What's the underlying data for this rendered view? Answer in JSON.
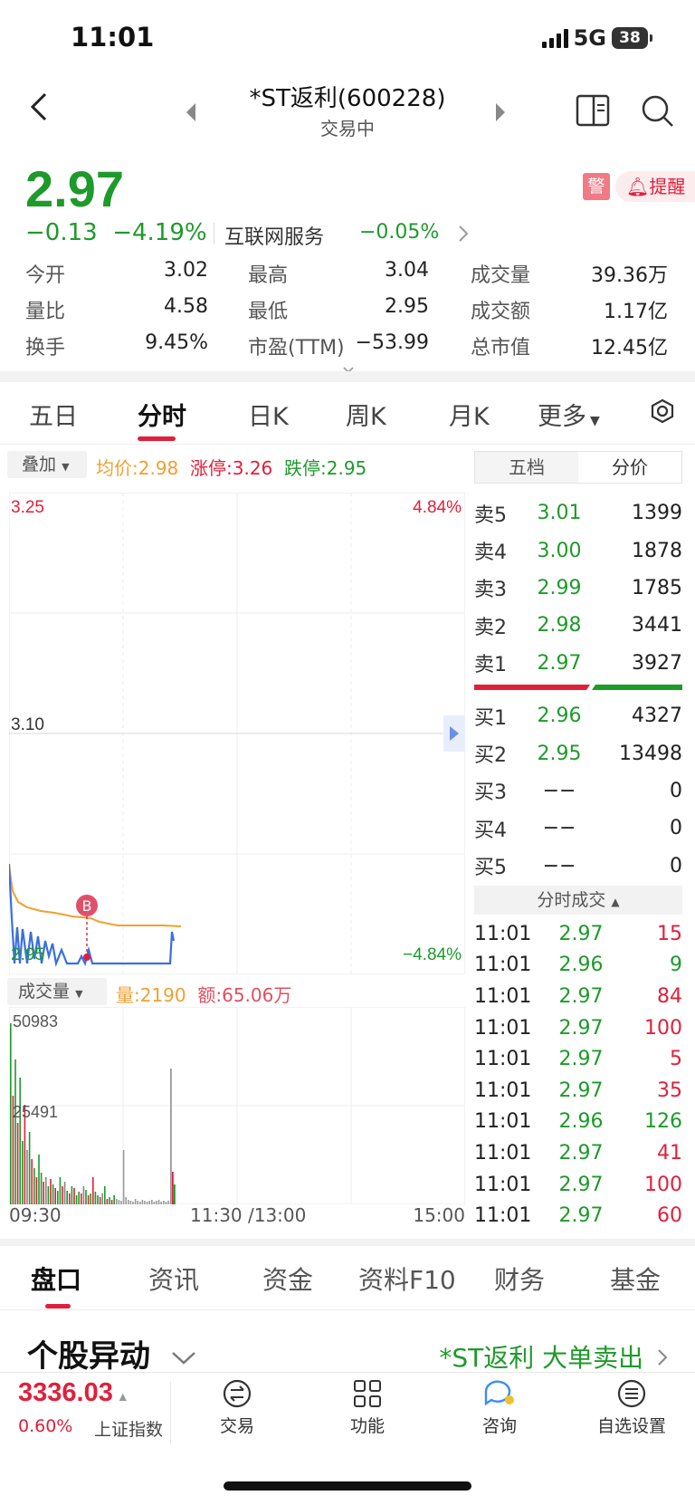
{
  "status": {
    "time": "11:01",
    "network": "5G",
    "battery": "38"
  },
  "nav": {
    "title": "*ST返利(600228)",
    "subtitle": "交易中"
  },
  "quote": {
    "price": "2.97",
    "change": "−0.13",
    "change_pct": "−4.19%",
    "sector": "互联网服务",
    "sector_chg": "−0.05%",
    "warn": "警",
    "alert": "提醒"
  },
  "stats": [
    [
      {
        "label": "今开",
        "value": "3.02",
        "color": "green"
      },
      {
        "label": "最高",
        "value": "3.04",
        "color": "green"
      },
      {
        "label": "成交量",
        "value": "39.36万",
        "color": "dark"
      }
    ],
    [
      {
        "label": "量比",
        "value": "4.58",
        "color": "dark"
      },
      {
        "label": "最低",
        "value": "2.95",
        "color": "green"
      },
      {
        "label": "成交额",
        "value": "1.17亿",
        "color": "dark"
      }
    ],
    [
      {
        "label": "换手",
        "value": "9.45%",
        "color": "dark"
      },
      {
        "label": "市盈(TTM)",
        "value": "−53.99",
        "color": "dark"
      },
      {
        "label": "总市值",
        "value": "12.45亿",
        "color": "dark"
      }
    ]
  ],
  "period_tabs": [
    "五日",
    "分时",
    "日K",
    "周K",
    "月K",
    "更多"
  ],
  "overlay": {
    "btn": "叠加",
    "avg": "均价:2.98",
    "limit_up": "涨停:3.26",
    "limit_down": "跌停:2.95"
  },
  "chart_axis": {
    "top_left": "3.25",
    "mid_left": "3.10",
    "bottom_left": "2.95",
    "top_right": "4.84%",
    "bottom_right": "−4.84%",
    "marker": "B"
  },
  "volume": {
    "btn": "成交量",
    "qty": "量:2190",
    "amt": "额:65.06万",
    "max": "50983",
    "mid": "25491"
  },
  "time_axis": [
    "09:30",
    "11:30 /13:00",
    "15:00"
  ],
  "orderbook_tabs": [
    "五档",
    "分价"
  ],
  "asks": [
    {
      "label": "卖5",
      "price": "3.01",
      "vol": "1399"
    },
    {
      "label": "卖4",
      "price": "3.00",
      "vol": "1878"
    },
    {
      "label": "卖3",
      "price": "2.99",
      "vol": "1785"
    },
    {
      "label": "卖2",
      "price": "2.98",
      "vol": "3441"
    },
    {
      "label": "卖1",
      "price": "2.97",
      "vol": "3927"
    }
  ],
  "bids": [
    {
      "label": "买1",
      "price": "2.96",
      "vol": "4327",
      "pcolor": "green"
    },
    {
      "label": "买2",
      "price": "2.95",
      "vol": "13498",
      "pcolor": "green"
    },
    {
      "label": "买3",
      "price": "−−",
      "vol": "0",
      "pcolor": "dark"
    },
    {
      "label": "买4",
      "price": "−−",
      "vol": "0",
      "pcolor": "dark"
    },
    {
      "label": "买5",
      "price": "−−",
      "vol": "0",
      "pcolor": "dark"
    }
  ],
  "ticks_header": "分时成交",
  "ticks": [
    {
      "t": "11:01",
      "p": "2.97",
      "v": "15",
      "pc": "green",
      "vc": "red"
    },
    {
      "t": "11:01",
      "p": "2.96",
      "v": "9",
      "pc": "green",
      "vc": "green"
    },
    {
      "t": "11:01",
      "p": "2.97",
      "v": "84",
      "pc": "green",
      "vc": "red"
    },
    {
      "t": "11:01",
      "p": "2.97",
      "v": "100",
      "pc": "green",
      "vc": "red"
    },
    {
      "t": "11:01",
      "p": "2.97",
      "v": "5",
      "pc": "green",
      "vc": "red"
    },
    {
      "t": "11:01",
      "p": "2.97",
      "v": "35",
      "pc": "green",
      "vc": "red"
    },
    {
      "t": "11:01",
      "p": "2.96",
      "v": "126",
      "pc": "green",
      "vc": "green"
    },
    {
      "t": "11:01",
      "p": "2.97",
      "v": "41",
      "pc": "green",
      "vc": "red"
    },
    {
      "t": "11:01",
      "p": "2.97",
      "v": "100",
      "pc": "green",
      "vc": "red"
    },
    {
      "t": "11:01",
      "p": "2.97",
      "v": "60",
      "pc": "green",
      "vc": "red"
    }
  ],
  "section_tabs": [
    "盘口",
    "资讯",
    "资金",
    "资料F10",
    "财务",
    "基金"
  ],
  "movers": {
    "title": "个股异动",
    "right": "*ST返利  大单卖出"
  },
  "index": {
    "value": "3336.03",
    "chg": "0.60%",
    "name": "上证指数"
  },
  "bottom_nav": [
    "交易",
    "功能",
    "咨询",
    "自选设置"
  ],
  "colors": {
    "up": "#e0203a",
    "down": "#1e9a2a",
    "avg": "#f0a030",
    "price_line": "#3a6fe0"
  }
}
